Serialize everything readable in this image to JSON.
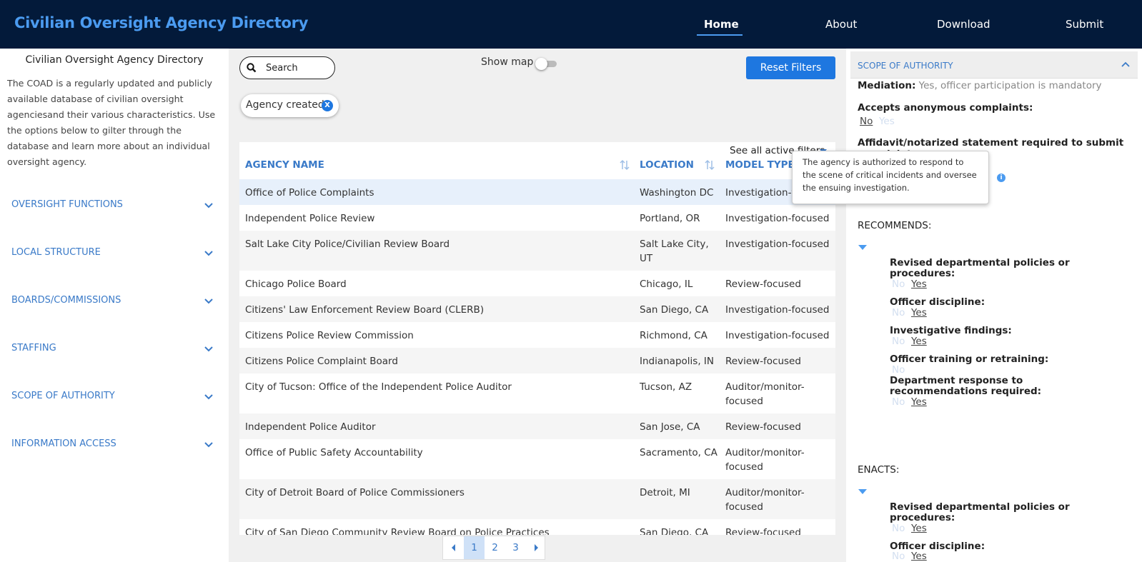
{
  "header": {
    "brand": "Civilian Oversight Agency Directory",
    "nav": [
      "Home",
      "About",
      "Download",
      "Submit"
    ],
    "active": "Home",
    "colors": {
      "bar": "#031a3a",
      "brand": "#4b9bf0"
    }
  },
  "sidebar": {
    "title": "Civilian Oversight Agency Directory",
    "description": "The COAD is a regularly updated and publicly available database of civilian oversight agenciesand their various characteristics. Use the options below to gilter through the database and learn more about an individual oversight agency.",
    "sections": [
      "OVERSIGHT FUNCTIONS",
      "LOCAL STRUCTURE",
      "BOARDS/COMMISSIONS",
      "STAFFING",
      "SCOPE OF AUTHORITY",
      "INFORMATION ACCESS"
    ]
  },
  "toolbar": {
    "search_placeholder": "Search",
    "show_map_label": "Show map",
    "show_map_on": false,
    "reset_label": "Reset Filters",
    "chip_label": "Agency created",
    "chip_remove": "X"
  },
  "table": {
    "see_all_filters": "See all active filters",
    "headers": {
      "name": "AGENCY NAME",
      "location": "LOCATION",
      "model": "MODEL TYPE"
    },
    "rows": [
      {
        "name": "Office of Police Complaints",
        "location": "Washington DC",
        "model": "Investigation-focused"
      },
      {
        "name": "Independent Police Review",
        "location": "Portland, OR",
        "model": "Investigation-focused"
      },
      {
        "name": "Salt Lake City Police/Civilian Review Board",
        "location": "Salt Lake City, UT",
        "model": "Investigation-focused"
      },
      {
        "name": "Chicago Police Board",
        "location": "Chicago, IL",
        "model": "Review-focused"
      },
      {
        "name": "Citizens' Law Enforcement Review Board (CLERB)",
        "location": "San Diego, CA",
        "model": "Investigation-focused"
      },
      {
        "name": "Citizens Police Review Commission",
        "location": "Richmond, CA",
        "model": "Investigation-focused"
      },
      {
        "name": "Citizens Police Complaint Board",
        "location": "Indianapolis, IN",
        "model": "Review-focused"
      },
      {
        "name": "City of Tucson: Office of the Independent Police Auditor",
        "location": "Tucson, AZ",
        "model": "Auditor/monitor-focused"
      },
      {
        "name": "Independent Police Auditor",
        "location": "San Jose, CA",
        "model": "Review-focused"
      },
      {
        "name": "Office of Public Safety Accountability",
        "location": "Sacramento, CA",
        "model": "Auditor/monitor-focused"
      },
      {
        "name": "City of Detroit Board of Police Commissioners",
        "location": "Detroit, MI",
        "model": "Auditor/monitor-focused"
      },
      {
        "name": "City of San Diego Community Review Board on Police Practices",
        "location": "San Diego, CA",
        "model": "Review-focused"
      }
    ]
  },
  "pager": {
    "pages": [
      "1",
      "2",
      "3"
    ],
    "current": "1"
  },
  "detail": {
    "section_title": "SCOPE OF AUTHORITY",
    "mediation_label": "Mediation:",
    "mediation_value": "Yes, officer participation is mandatory",
    "anon_label": "Accepts anonymous complaints:",
    "no": "No",
    "yes": "Yes",
    "affidavit_label": "Affidavit/notarized statement required to submit complaint:",
    "tooltip": "The agency is authorized to respond to the scene of critical incidents and oversee the ensuing investigation.",
    "info_glyph": "i",
    "recommends_label": "RECOMMENDS:",
    "recommends_items": [
      "Revised departmental policies or procedures:",
      "Officer discipline:",
      "Investigative findings:",
      "Officer training or retraining:",
      "Department response to recommendations required:"
    ],
    "enacts_label": "ENACTS:",
    "enacts_items": [
      "Revised departmental policies or procedures:",
      "Officer discipline:"
    ]
  }
}
